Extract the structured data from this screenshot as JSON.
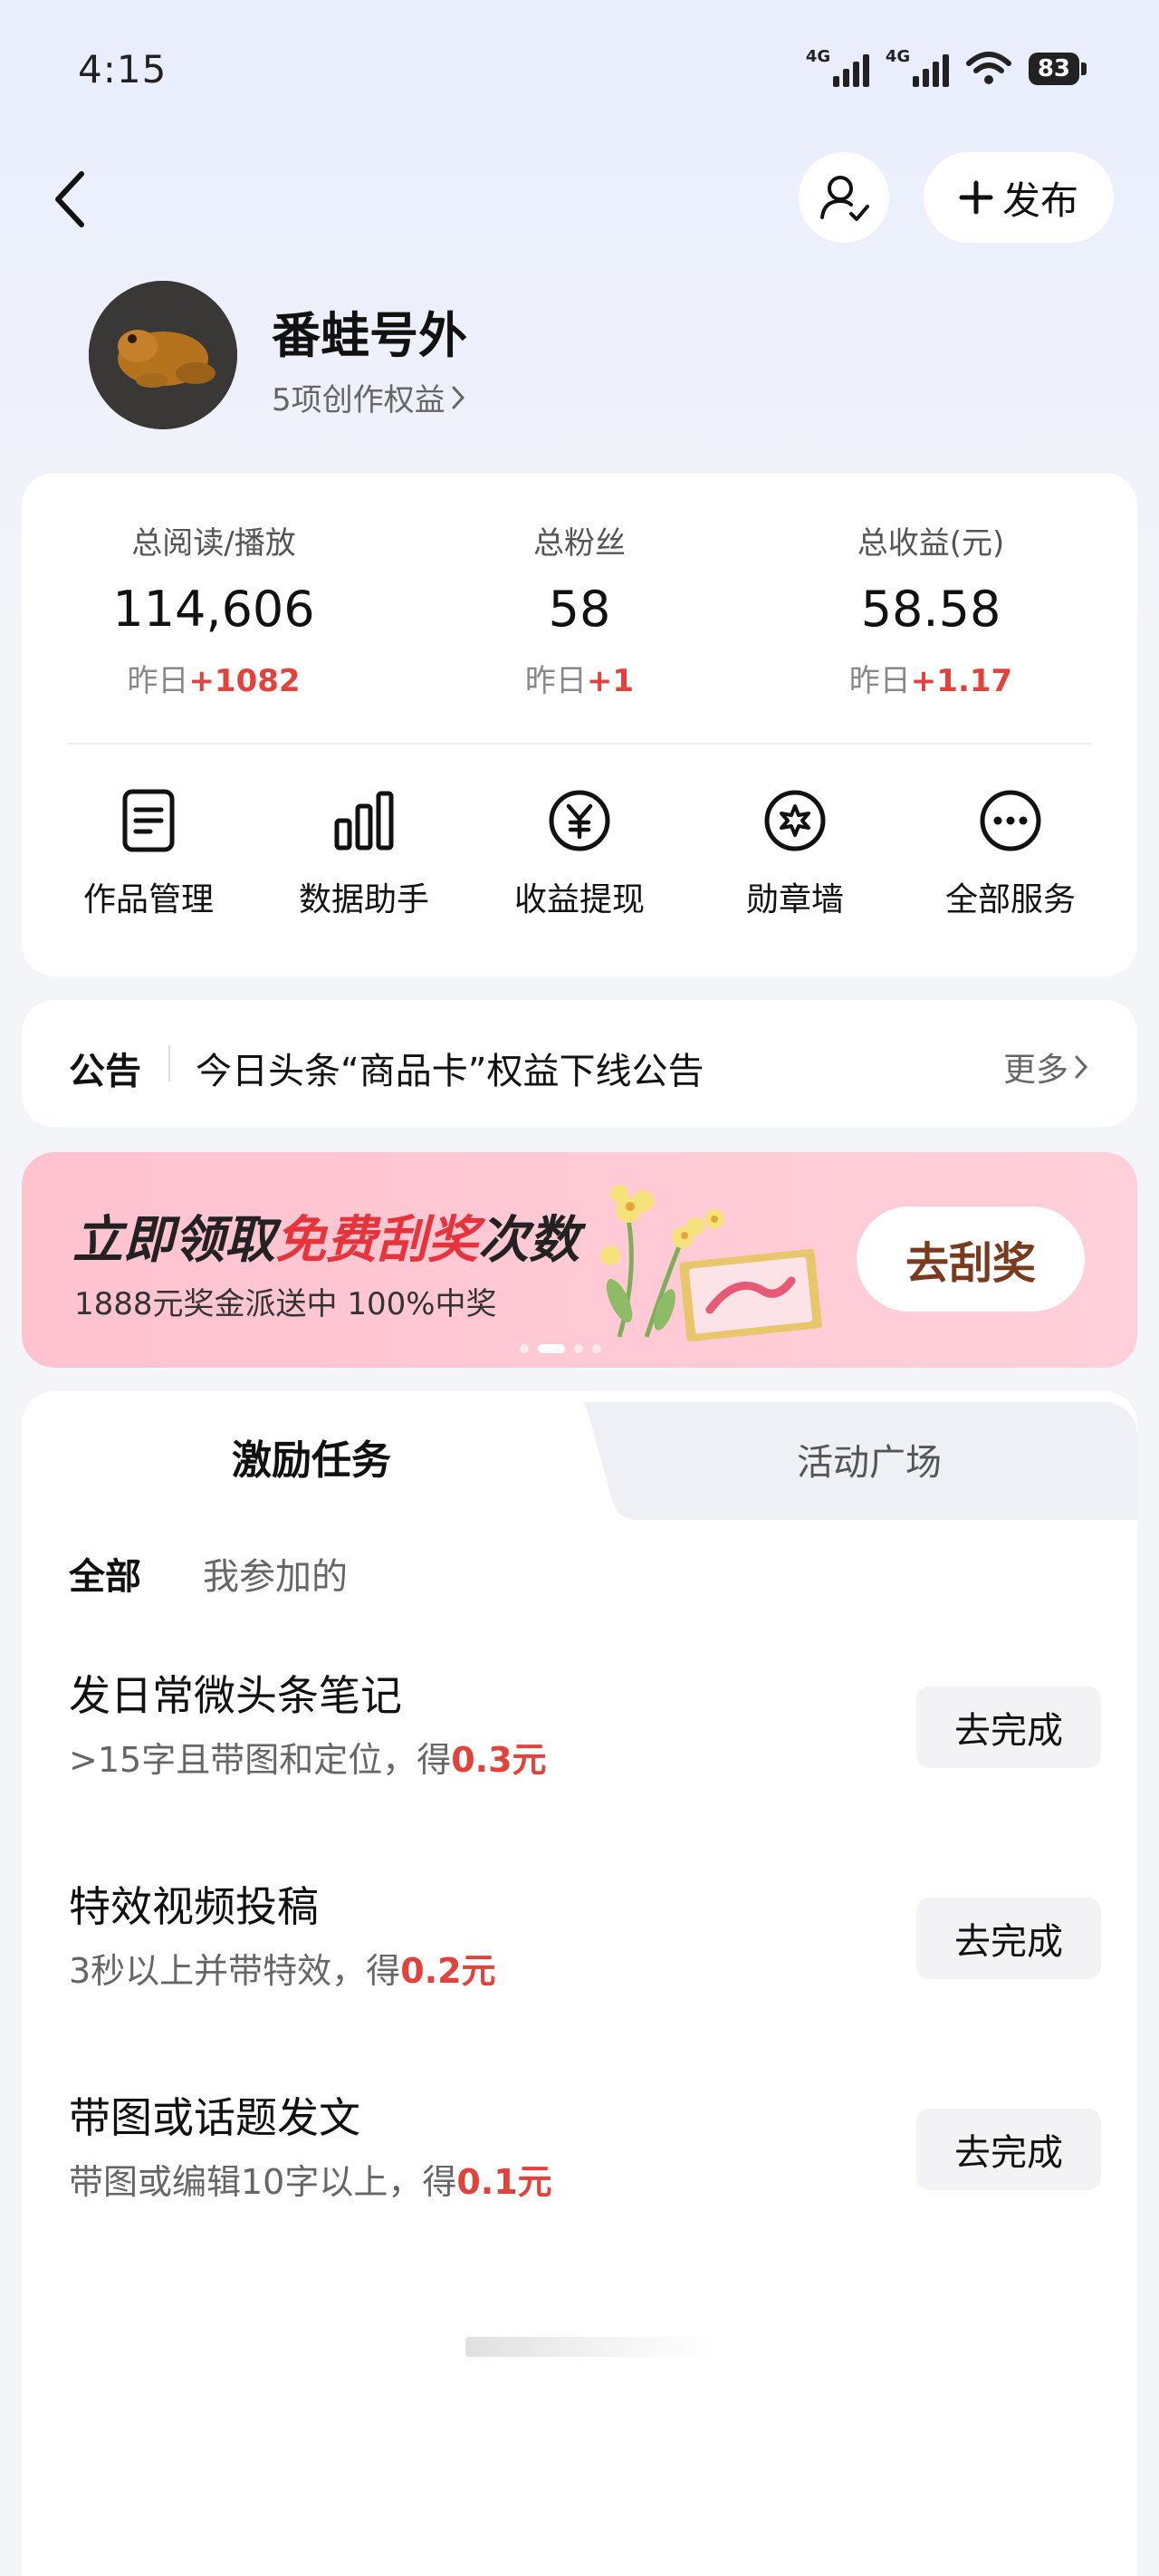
{
  "status_bar": {
    "time": "4:15",
    "signal1_label": "4G",
    "signal2_label": "4G",
    "battery": "83"
  },
  "header": {
    "publish_label": "发布"
  },
  "profile": {
    "name": "番蛙号外",
    "rights": "5项创作权益"
  },
  "stats": [
    {
      "label": "总阅读/播放",
      "value": "114,606",
      "delta_prefix": "昨日",
      "delta": "+1082"
    },
    {
      "label": "总粉丝",
      "value": "58",
      "delta_prefix": "昨日",
      "delta": "+1"
    },
    {
      "label": "总收益(元)",
      "value": "58.58",
      "delta_prefix": "昨日",
      "delta": "+1.17"
    }
  ],
  "services": [
    {
      "label": "作品管理",
      "icon": "document-icon"
    },
    {
      "label": "数据助手",
      "icon": "bar-chart-icon"
    },
    {
      "label": "收益提现",
      "icon": "yuan-icon"
    },
    {
      "label": "勋章墙",
      "icon": "medal-icon"
    },
    {
      "label": "全部服务",
      "icon": "more-icon"
    }
  ],
  "announcement": {
    "label": "公告",
    "text": "今日头条“商品卡”权益下线公告",
    "more": "更多"
  },
  "banner": {
    "title_part1": "立即领取",
    "title_highlight": "免费刮奖",
    "title_part2": "次数",
    "subtitle": "1888元奖金派送中 100%中奖",
    "button": "去刮奖"
  },
  "tabs": {
    "active": "激励任务",
    "inactive": "活动广场"
  },
  "filters": {
    "all": "全部",
    "mine": "我参加的"
  },
  "tasks": [
    {
      "title": "发日常微头条笔记",
      "desc": ">15字且带图和定位，得",
      "reward": "0.3元",
      "button": "去完成"
    },
    {
      "title": "特效视频投稿",
      "desc": "3秒以上并带特效，得",
      "reward": "0.2元",
      "button": "去完成"
    },
    {
      "title": "带图或话题发文",
      "desc": "带图或编辑10字以上，得",
      "reward": "0.1元",
      "button": "去完成"
    }
  ],
  "colors": {
    "accent_red": "#e2423c",
    "banner_pink": "#ffc3cf",
    "banner_button_text": "#7a3a1e"
  }
}
